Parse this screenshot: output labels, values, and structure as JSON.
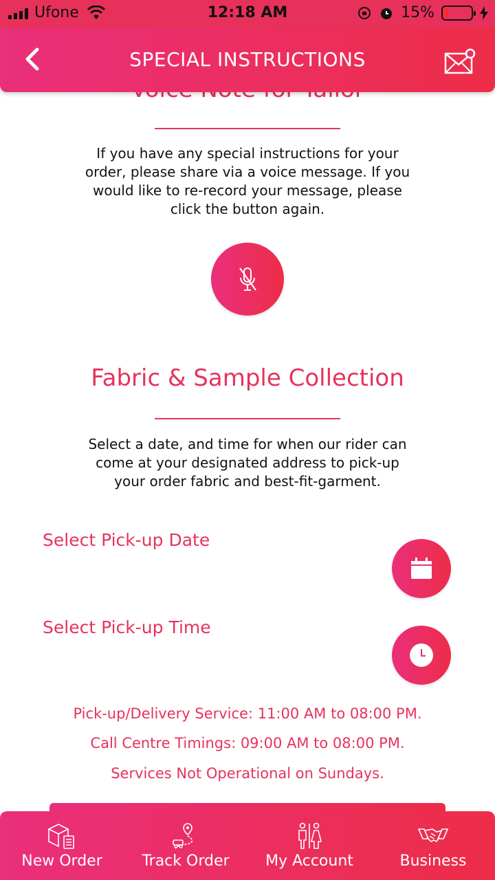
{
  "status_bar": {
    "carrier": "Ufone",
    "time": "12:18 AM",
    "battery": "15%",
    "battery_level": 0.15
  },
  "header": {
    "title": "SPECIAL INSTRUCTIONS",
    "back_icon": "chevron-left-icon",
    "mail_icon": "mail-notification-icon"
  },
  "voice_note": {
    "title": "Voice Note for Tailor",
    "description": "If you have any special instructions for your order, please share via a voice message. If you would like to re-record your message, please click the button again.",
    "mic_icon": "mic-off-icon"
  },
  "fabric": {
    "title": "Fabric & Sample Collection",
    "description": "Select a date, and time for when our rider can come at your designated address to pick-up your order fabric and best-fit-garment.",
    "date_label": "Select Pick-up Date",
    "time_label": "Select Pick-up Time"
  },
  "info": {
    "line1": "Pick-up/Delivery Service: 11:00 AM to 08:00 PM.",
    "line2": "Call Centre Timings: 09:00 AM to 08:00 PM.",
    "line3": "Services Not Operational on Sundays."
  },
  "tabs": [
    {
      "label": "New Order",
      "icon": "box-checklist-icon"
    },
    {
      "label": "Track Order",
      "icon": "route-pin-icon"
    },
    {
      "label": "My Account",
      "icon": "people-icon"
    },
    {
      "label": "Business",
      "icon": "handshake-icon"
    }
  ],
  "colors": {
    "accent": "#e6335b",
    "gradient_start": "#ea2f7b",
    "gradient_end": "#ed2d48"
  }
}
